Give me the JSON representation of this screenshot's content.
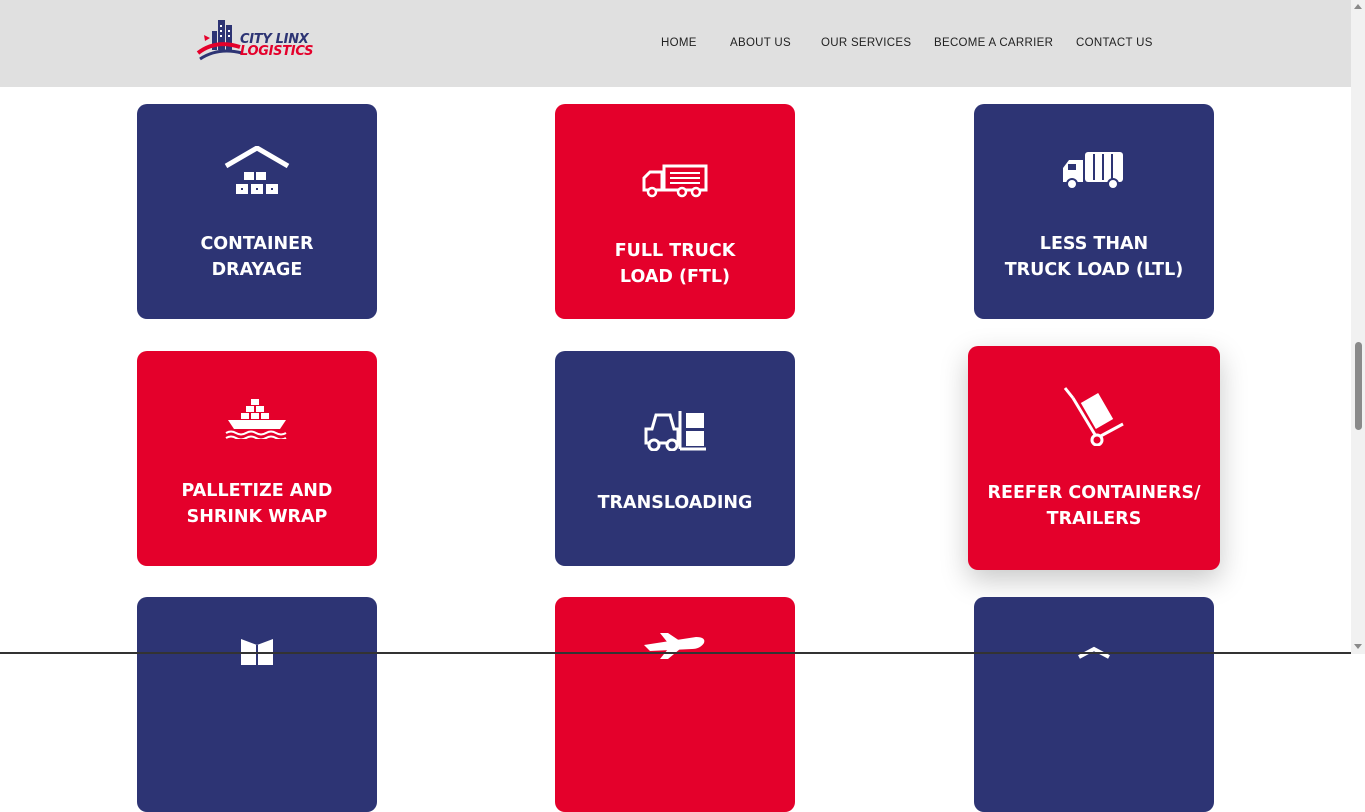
{
  "header": {
    "logo": {
      "line1": "CITY LINX",
      "line2": "LOGISTICS"
    },
    "nav": [
      {
        "label": "HOME"
      },
      {
        "label": "ABOUT US"
      },
      {
        "label": "OUR SERVICES"
      },
      {
        "label": "BECOME A CARRIER"
      },
      {
        "label": "CONTACT US"
      }
    ]
  },
  "services": [
    {
      "title": "CONTAINER\nDRAYAGE",
      "icon": "warehouse-icon",
      "color": "#2d3474"
    },
    {
      "title": "FULL TRUCK\nLOAD (FTL)",
      "icon": "truck-icon",
      "color": "#e4002b"
    },
    {
      "title": "LESS THAN\nTRUCK LOAD (LTL)",
      "icon": "box-truck-icon",
      "color": "#2d3474"
    },
    {
      "title": "PALLETIZE AND\nSHRINK WRAP",
      "icon": "cargo-ship-icon",
      "color": "#e4002b"
    },
    {
      "title": "TRANSLOADING",
      "icon": "forklift-icon",
      "color": "#2d3474"
    },
    {
      "title": "REEFER CONTAINERS/\nTRAILERS",
      "icon": "hand-truck-icon",
      "color": "#e4002b"
    },
    {
      "title": "",
      "icon": "boxes-icon",
      "color": "#2d3474"
    },
    {
      "title": "",
      "icon": "airplane-icon",
      "color": "#e4002b"
    },
    {
      "title": "",
      "icon": "warehouse-icon",
      "color": "#2d3474"
    }
  ],
  "colors": {
    "navy": "#2d3474",
    "red": "#e4002b",
    "header_bg": "#e0e0e0"
  }
}
